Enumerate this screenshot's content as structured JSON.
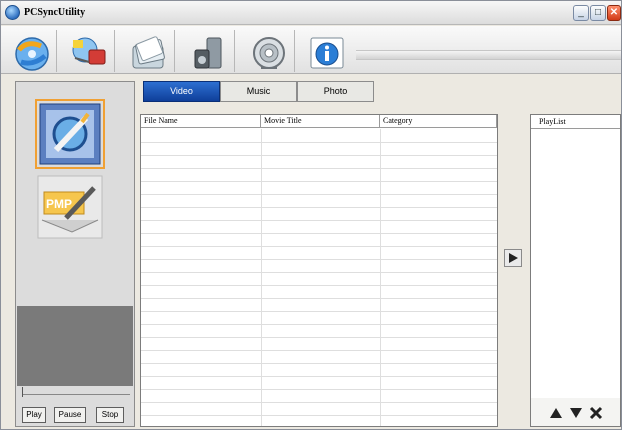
{
  "window": {
    "title": "PCSyncUtility",
    "controls": [
      "minimize",
      "maximize",
      "close"
    ]
  },
  "toolbar": {
    "buttons": [
      {
        "name": "sync-icon"
      },
      {
        "name": "transfer-icon"
      },
      {
        "name": "files-icon"
      },
      {
        "name": "media-icon"
      },
      {
        "name": "settings-icon"
      },
      {
        "name": "info-icon"
      }
    ]
  },
  "sidebar": {
    "modes": [
      {
        "name": "edit-mode-icon",
        "selected": true
      },
      {
        "name": "pmp-mode-icon",
        "selected": false
      }
    ],
    "pmp_badge": "PMP",
    "controls": {
      "play": "Play",
      "pause": "Pause",
      "stop": "Stop"
    }
  },
  "tabs": [
    {
      "label": "Video",
      "active": true
    },
    {
      "label": "Music",
      "active": false
    },
    {
      "label": "Photo",
      "active": false
    }
  ],
  "filelist": {
    "columns": [
      "File Name",
      "Movie Title",
      "Category"
    ],
    "rows": []
  },
  "playlist": {
    "header": "PlayList",
    "controls": [
      "move-up-icon",
      "move-down-icon",
      "remove-icon"
    ]
  },
  "colors": {
    "active_tab": "#1f56b8",
    "window_bg": "#ece9e1",
    "preview_bg": "#7a7a7a"
  }
}
